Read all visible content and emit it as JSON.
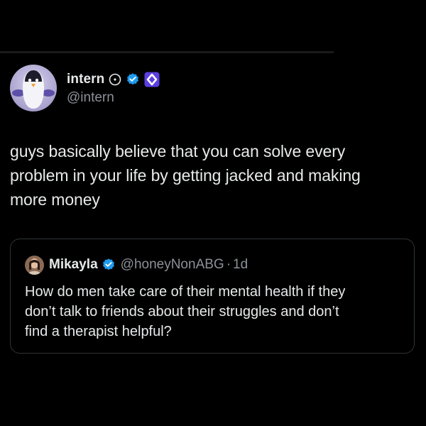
{
  "tweet": {
    "author": {
      "display_name": "intern",
      "handle": "@intern",
      "avatar_icon": "penguin-avatar-icon",
      "badges": [
        "clock-icon",
        "verified-badge-icon",
        "affiliate-badge-icon"
      ]
    },
    "text_lines": [
      "guys basically believe that you can solve every",
      "problem in your life by getting jacked and making",
      "more money"
    ]
  },
  "quote": {
    "author": {
      "display_name": "Mikayla",
      "handle": "@honeyNonABG",
      "separator": "·",
      "time": "1d",
      "avatar_icon": "user-photo-avatar-icon"
    },
    "text_lines": [
      "How do men take care of their mental health if they",
      "don’t talk to friends about their struggles and don’t",
      "find a therapist helpful?"
    ]
  },
  "colors": {
    "background": "#000000",
    "primary_text": "#e7e9ea",
    "secondary_text": "#8b9198",
    "verified_blue": "#1d9bf0",
    "affiliate_purple": "#5b3fe0",
    "card_border": "#2f3336"
  }
}
